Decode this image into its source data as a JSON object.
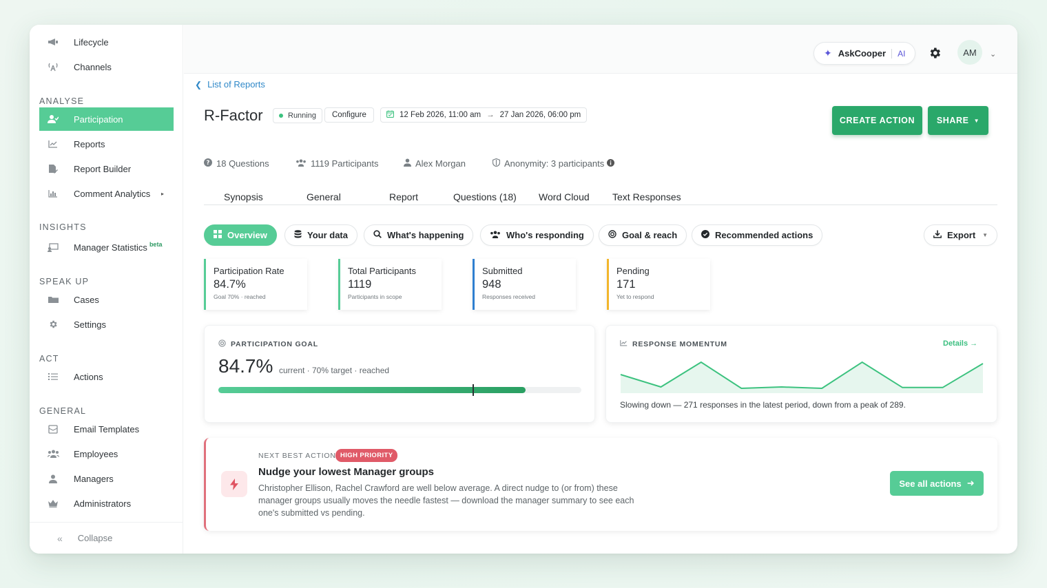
{
  "sidebar": {
    "top_items": [
      {
        "label": "Lifecycle",
        "icon": "megaphone-icon"
      },
      {
        "label": "Channels",
        "icon": "broadcast-icon"
      }
    ],
    "sections": [
      {
        "heading": "ANALYSE",
        "items": [
          {
            "label": "Participation",
            "icon": "user-check-icon",
            "active": true
          },
          {
            "label": "Reports",
            "icon": "line-chart-icon"
          },
          {
            "label": "Report Builder",
            "icon": "file-edit-icon"
          },
          {
            "label": "Comment Analytics",
            "icon": "bar-chart-icon",
            "has_submenu": true
          }
        ]
      },
      {
        "heading": "INSIGHTS",
        "items": [
          {
            "label": "Manager Statistics",
            "badge": "beta",
            "icon": "presentation-icon"
          }
        ]
      },
      {
        "heading": "SPEAK UP",
        "items": [
          {
            "label": "Cases",
            "icon": "folder-icon"
          },
          {
            "label": "Settings",
            "icon": "gear-icon"
          }
        ]
      },
      {
        "heading": "ACT",
        "items": [
          {
            "label": "Actions",
            "icon": "list-icon"
          }
        ]
      },
      {
        "heading": "GENERAL",
        "items": [
          {
            "label": "Email Templates",
            "icon": "email-template-icon"
          },
          {
            "label": "Employees",
            "icon": "users-icon"
          },
          {
            "label": "Managers",
            "icon": "user-icon"
          },
          {
            "label": "Administrators",
            "icon": "crown-icon"
          }
        ]
      }
    ],
    "collapse_label": "Collapse"
  },
  "topbar": {
    "askcooper_label": "AskCooper",
    "askcooper_ai": "AI",
    "avatar_initials": "AM"
  },
  "breadcrumb": "List of Reports",
  "report": {
    "title": "R-Factor",
    "status": "Running",
    "configure_label": "Configure",
    "date_start": "12 Feb 2026, 11:00 am",
    "date_end": "27 Jan 2026, 06:00 pm",
    "create_action_label": "CREATE ACTION",
    "share_label": "SHARE"
  },
  "meta": {
    "questions": "18 Questions",
    "participants": "1119 Participants",
    "owner": "Alex Morgan",
    "anonymity": "Anonymity: 3 participants"
  },
  "tabs": [
    "Synopsis",
    "General",
    "Report",
    "Questions (18)",
    "Word Cloud",
    "Text Responses"
  ],
  "chips": {
    "overview": "Overview",
    "your_data": "Your data",
    "whats_happening": "What's happening",
    "whos_responding": "Who's responding",
    "goal_reach": "Goal & reach",
    "recommended": "Recommended actions",
    "export": "Export"
  },
  "stats": [
    {
      "label": "Participation Rate",
      "value": "84.7%",
      "sub": "Goal 70% · reached",
      "color": "#56cc96"
    },
    {
      "label": "Total Participants",
      "value": "1119",
      "sub": "Participants in scope",
      "color": "#56cc96"
    },
    {
      "label": "Submitted",
      "value": "948",
      "sub": "Responses received",
      "color": "#2f7fd0"
    },
    {
      "label": "Pending",
      "value": "171",
      "sub": "Yet to respond",
      "color": "#f2b62b"
    }
  ],
  "goal_card": {
    "title": "PARTICIPATION GOAL",
    "value": "84.7%",
    "subtitle": "current · 70% target · reached",
    "current_pct": 84.7,
    "target_pct": 70
  },
  "momentum_card": {
    "title": "RESPONSE MOMENTUM",
    "details_label": "Details",
    "summary": "Slowing down — 271 responses in the latest period, down from a peak of 289."
  },
  "chart_data": {
    "type": "area",
    "x": [
      1,
      2,
      3,
      4,
      5,
      6,
      7,
      8,
      9,
      10
    ],
    "values": [
      0.55,
      0.1,
      1.0,
      0.05,
      0.1,
      0.05,
      1.0,
      0.08,
      0.08,
      0.95
    ],
    "title": "",
    "xlabel": "",
    "ylabel": "",
    "grid": false,
    "color": "#3cc27f"
  },
  "next_best_action": {
    "eyebrow": "NEXT BEST ACTION",
    "priority": "HIGH PRIORITY",
    "title": "Nudge your lowest Manager groups",
    "body": "Christopher Ellison, Rachel Crawford are well below average. A direct nudge to (or from) these manager groups usually moves the needle fastest — download the manager summary to see each one's submitted vs pending.",
    "button_label": "See all actions"
  }
}
